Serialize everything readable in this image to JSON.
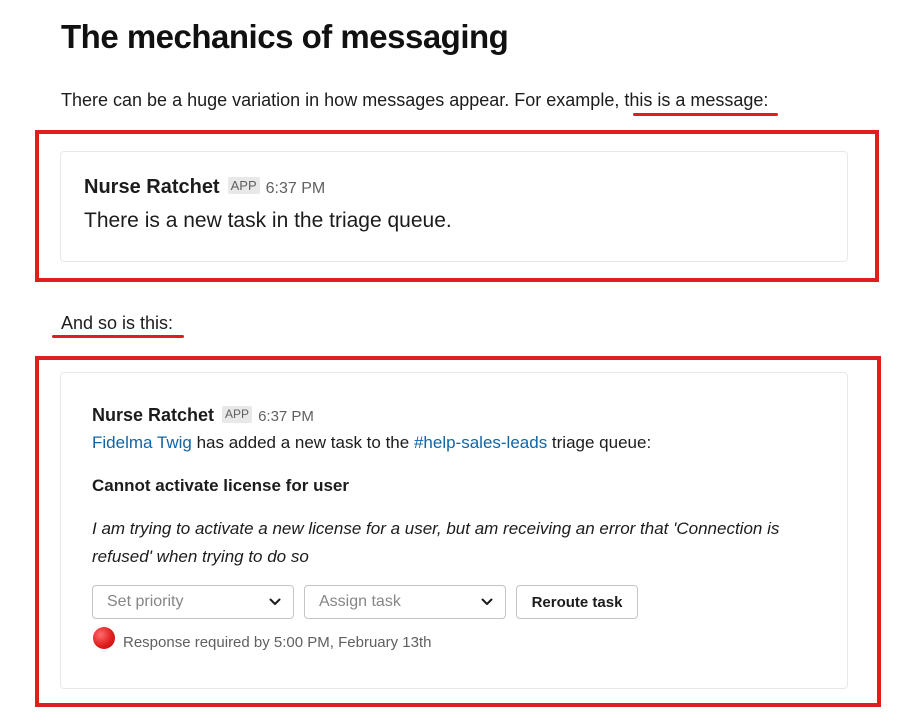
{
  "heading": "The mechanics of messaging",
  "intro": {
    "text": "There can be a huge variation in how messages appear. For example, ",
    "emphasis": "this is a message:"
  },
  "second_intro": "And so is this:",
  "message1": {
    "sender": "Nurse Ratchet",
    "badge": "APP",
    "time": "6:37 PM",
    "text": "There is a new task in the triage queue."
  },
  "message2": {
    "sender": "Nurse Ratchet",
    "badge": "APP",
    "time": "6:37 PM",
    "user_link": "Fidelma Twig",
    "text_middle": " has added a new task to the ",
    "channel_link": "#help-sales-leads",
    "text_end": " triage queue:",
    "task_title": "Cannot activate license for user",
    "task_description": "I am trying to activate a new license for a user, but am receiving an error that 'Connection is refused' when trying to do so",
    "priority_placeholder": "Set priority",
    "assign_placeholder": "Assign task",
    "reroute_label": "Reroute task",
    "status_icon": "red-circle-icon",
    "status_text": "Response required by 5:00 PM, February 13th"
  },
  "colors": {
    "highlight": "#e01e1e",
    "link": "#1264a3",
    "status_dot": "#e01e1e"
  }
}
